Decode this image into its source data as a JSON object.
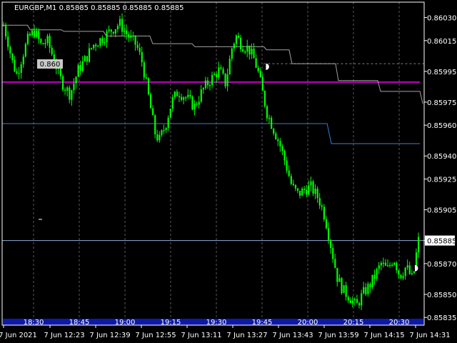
{
  "header": {
    "symbol": "EURGBP,M1",
    "ohlc": "0.85885 0.85885 0.85885 0.85885"
  },
  "colors": {
    "background": "#000000",
    "frame": "#ffffff",
    "grid": "#808080",
    "bull_candle": "#00ff00",
    "magenta_line": "#c000c0",
    "blue_line": "#3b7fd0",
    "white_step_line": "#c0c0c0",
    "bid_line": "#8faedc",
    "session_bar": "#0d1aa8",
    "label_box": "#c8c8c8",
    "label_text": "#000000"
  },
  "chart_data": {
    "type": "candlestick",
    "y_axis": {
      "ylim": [
        0.8583,
        0.8604
      ],
      "ticks": [
        "0.86030",
        "0.86015",
        "0.85995",
        "0.85975",
        "0.85960",
        "0.85940",
        "0.85925",
        "0.85905",
        "0.85885",
        "0.85870",
        "0.85850",
        "0.85835"
      ]
    },
    "current_price": "0.85885",
    "price_label": "0.860",
    "time_axis_labels": [
      "7 Jun 2021",
      "7 Jun 12:23",
      "7 Jun 12:39",
      "7 Jun 12:55",
      "7 Jun 13:11",
      "7 Jun 13:27",
      "7 Jun 13:43",
      "7 Jun 13:59",
      "7 Jun 14:15",
      "7 Jun 14:31"
    ],
    "session_labels": [
      "18:30",
      "18:45",
      "19:00",
      "19:15",
      "19:30",
      "19:45",
      "20:00",
      "20:15",
      "20:30"
    ],
    "levels": {
      "magenta": 0.85988,
      "blue_left": 0.85961,
      "blue_right": 0.85948,
      "bid": 0.85885
    },
    "white_step": [
      [
        0.0,
        0.86025
      ],
      [
        0.06,
        0.86022
      ],
      [
        0.14,
        0.86021
      ],
      [
        0.24,
        0.86018
      ],
      [
        0.35,
        0.86013
      ],
      [
        0.45,
        0.86011
      ],
      [
        0.55,
        0.86011
      ],
      [
        0.62,
        0.86009
      ],
      [
        0.68,
        0.86
      ],
      [
        0.79,
        0.85989
      ],
      [
        0.89,
        0.85982
      ],
      [
        0.99,
        0.85974
      ]
    ],
    "close_path": [
      [
        0.0,
        0.86025
      ],
      [
        0.01,
        0.86015
      ],
      [
        0.02,
        0.86002
      ],
      [
        0.032,
        0.85993
      ],
      [
        0.045,
        0.86005
      ],
      [
        0.06,
        0.86017
      ],
      [
        0.075,
        0.86021
      ],
      [
        0.09,
        0.86012
      ],
      [
        0.105,
        0.86015
      ],
      [
        0.125,
        0.86
      ],
      [
        0.14,
        0.85988
      ],
      [
        0.16,
        0.8598
      ],
      [
        0.18,
        0.85996
      ],
      [
        0.2,
        0.86004
      ],
      [
        0.215,
        0.86012
      ],
      [
        0.24,
        0.86017
      ],
      [
        0.26,
        0.86022
      ],
      [
        0.28,
        0.86026
      ],
      [
        0.3,
        0.86018
      ],
      [
        0.32,
        0.86012
      ],
      [
        0.335,
        0.86
      ],
      [
        0.345,
        0.85985
      ],
      [
        0.355,
        0.8597
      ],
      [
        0.365,
        0.85955
      ],
      [
        0.375,
        0.8595
      ],
      [
        0.39,
        0.8596
      ],
      [
        0.405,
        0.85975
      ],
      [
        0.42,
        0.85982
      ],
      [
        0.44,
        0.85978
      ],
      [
        0.46,
        0.85972
      ],
      [
        0.48,
        0.85983
      ],
      [
        0.5,
        0.8599
      ],
      [
        0.52,
        0.85996
      ],
      [
        0.535,
        0.85987
      ],
      [
        0.55,
        0.8601
      ],
      [
        0.56,
        0.86018
      ],
      [
        0.575,
        0.86012
      ],
      [
        0.59,
        0.8601
      ],
      [
        0.605,
        0.86002
      ],
      [
        0.615,
        0.85993
      ],
      [
        0.625,
        0.8598
      ],
      [
        0.635,
        0.85968
      ],
      [
        0.65,
        0.85958
      ],
      [
        0.665,
        0.85948
      ],
      [
        0.68,
        0.85935
      ],
      [
        0.695,
        0.8592
      ],
      [
        0.71,
        0.85915
      ],
      [
        0.725,
        0.85918
      ],
      [
        0.74,
        0.8592
      ],
      [
        0.76,
        0.85912
      ],
      [
        0.775,
        0.859
      ],
      [
        0.79,
        0.8588
      ],
      [
        0.805,
        0.8586
      ],
      [
        0.82,
        0.85852
      ],
      [
        0.835,
        0.85848
      ],
      [
        0.85,
        0.85842
      ],
      [
        0.865,
        0.8585
      ],
      [
        0.88,
        0.85855
      ],
      [
        0.895,
        0.85862
      ],
      [
        0.91,
        0.8587
      ],
      [
        0.925,
        0.85866
      ],
      [
        0.94,
        0.85874
      ],
      [
        0.955,
        0.85862
      ],
      [
        0.97,
        0.85868
      ],
      [
        0.985,
        0.8586
      ],
      [
        1.0,
        0.85885
      ]
    ]
  }
}
